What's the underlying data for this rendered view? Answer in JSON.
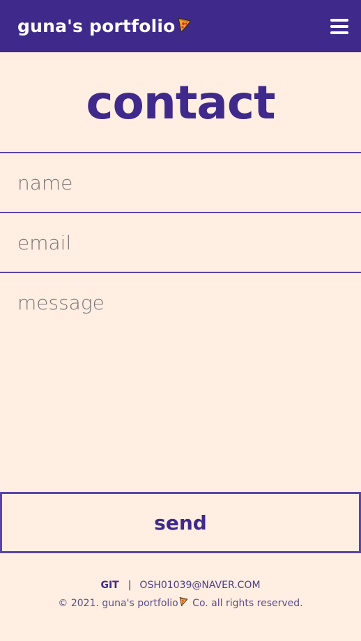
{
  "navbar": {
    "brand": "guna's portfolio",
    "brand_icon": "pizza-icon",
    "menu_icon": "hamburger-menu-icon"
  },
  "main": {
    "title": "contact",
    "form": {
      "name_placeholder": "name",
      "email_placeholder": "email",
      "message_placeholder": "message",
      "send_label": "send"
    }
  },
  "footer": {
    "git_label": "GIT",
    "separator": "|",
    "email": "OSH01039@NAVER.COM",
    "copyright_prefix": "© 2021. guna's portfolio",
    "copyright_suffix": " Co. all rights reserved."
  },
  "colors": {
    "primary": "#3F2A8C",
    "background": "#FFEEE1",
    "white": "#FFFFFF"
  }
}
